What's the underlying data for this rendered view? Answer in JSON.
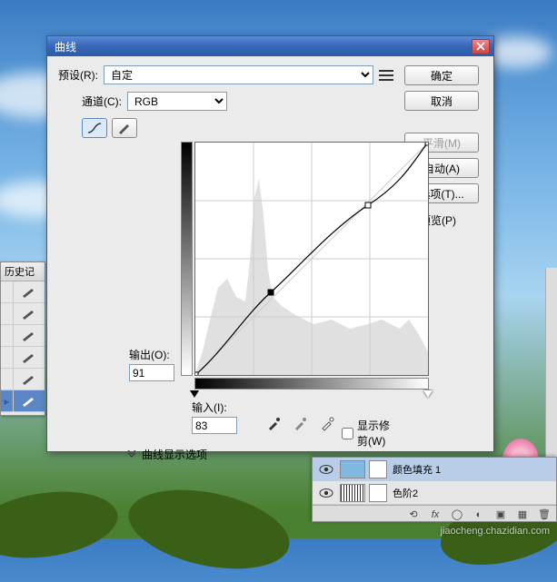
{
  "history_palette": {
    "title": "历史记",
    "items": [
      {
        "icon": "brush",
        "checked": false
      },
      {
        "icon": "brush",
        "checked": false
      },
      {
        "icon": "brush",
        "checked": false
      },
      {
        "icon": "brush",
        "checked": false
      },
      {
        "icon": "brush",
        "checked": false
      },
      {
        "icon": "brush",
        "checked": true
      }
    ]
  },
  "dialog": {
    "title": "曲线",
    "preset_label": "预设(R):",
    "preset_value": "自定",
    "channel_label": "通道(C):",
    "channel_value": "RGB",
    "output_label": "输出(O):",
    "output_value": "91",
    "input_label": "输入(I):",
    "input_value": "83",
    "show_clip_label": "显示修剪(W)",
    "disclosure_label": "曲线显示选项",
    "buttons": {
      "ok": "确定",
      "cancel": "取消",
      "smooth": "平滑(M)",
      "auto": "自动(A)",
      "options": "选项(T)..."
    },
    "preview_label": "预览(P)",
    "preview_checked": true
  },
  "chart_data": {
    "type": "line",
    "title": "曲线",
    "xlabel": "输入",
    "ylabel": "输出",
    "xlim": [
      0,
      255
    ],
    "ylim": [
      0,
      255
    ],
    "points": [
      {
        "input": 0,
        "output": 0
      },
      {
        "input": 83,
        "output": 91,
        "selected": true
      },
      {
        "input": 190,
        "output": 187
      },
      {
        "input": 255,
        "output": 255
      }
    ],
    "histogram_hint": "grayscale image histogram background"
  },
  "layers": {
    "items": [
      {
        "name": "颜色填充 1",
        "visible": true,
        "thumb": "fill",
        "selected": true
      },
      {
        "name": "色阶2",
        "visible": true,
        "thumb": "levels",
        "selected": false
      }
    ],
    "footer_icons": [
      "link",
      "fx",
      "mask",
      "adjust",
      "group",
      "new",
      "trash"
    ]
  },
  "watermark": "jiaocheng.chazidian.com"
}
